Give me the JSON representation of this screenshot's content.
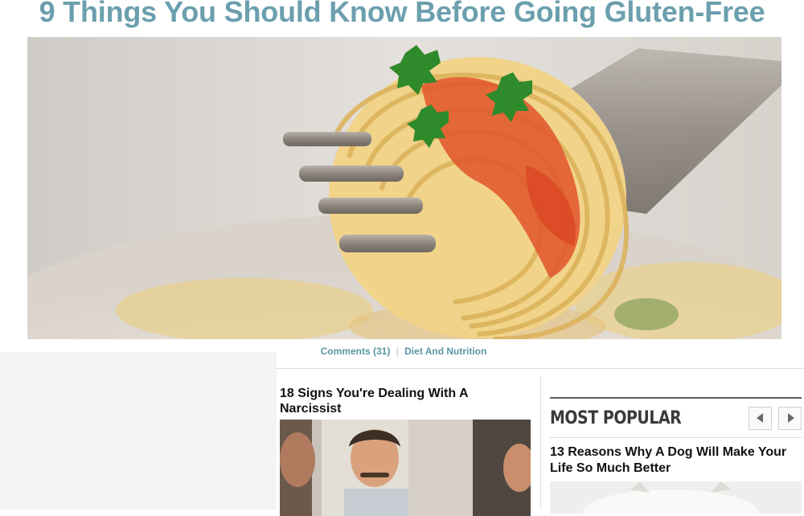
{
  "article": {
    "title": "9 Things You Should Know Before Going Gluten-Free",
    "hero_image": "spaghetti-on-fork",
    "comments_label": "Comments (31)",
    "separator": "|",
    "category": "Diet And Nutrition"
  },
  "related": {
    "headline": "18 Signs You're Dealing With A Narcissist",
    "image": "man-smiling-in-mirror"
  },
  "most_popular": {
    "heading": "MOST POPULAR",
    "prev_icon": "chevron-left-icon",
    "next_icon": "chevron-right-icon",
    "items": [
      {
        "headline": "13 Reasons Why A Dog Will Make Your Life So Much Better",
        "image": "white-dog"
      }
    ]
  },
  "colors": {
    "title": "#6b9fae",
    "meta_link": "#5b96a6",
    "popular_heading": "#3a3a3a"
  }
}
